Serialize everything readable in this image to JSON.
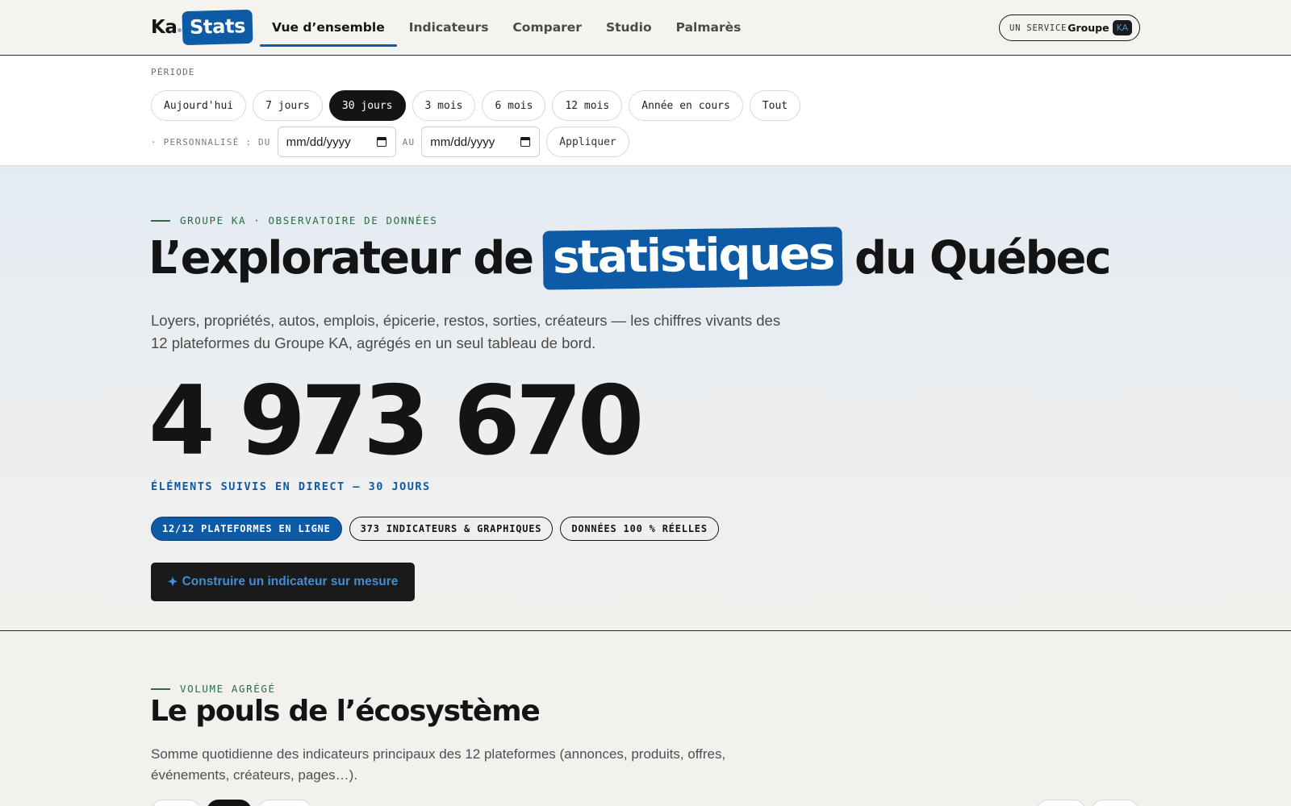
{
  "header": {
    "logo_ka": "Ka",
    "logo_stats": "Stats",
    "nav": [
      {
        "label": "Vue d’ensemble",
        "active": true
      },
      {
        "label": "Indicateurs",
        "active": false
      },
      {
        "label": "Comparer",
        "active": false
      },
      {
        "label": "Studio",
        "active": false
      },
      {
        "label": "Palmarès",
        "active": false
      }
    ],
    "service": {
      "prefix": "UN SERVICE",
      "groupe": "Groupe",
      "ka": "KA"
    }
  },
  "period": {
    "label": "PÉRIODE",
    "options": [
      {
        "label": "Aujourd'hui",
        "active": false
      },
      {
        "label": "7 jours",
        "active": false
      },
      {
        "label": "30 jours",
        "active": true
      },
      {
        "label": "3 mois",
        "active": false
      },
      {
        "label": "6 mois",
        "active": false
      },
      {
        "label": "12 mois",
        "active": false
      },
      {
        "label": "Année en cours",
        "active": false
      },
      {
        "label": "Tout",
        "active": false
      }
    ],
    "custom_label": "· PERSONNALISÉ : DU",
    "from_placeholder": "mm/dd/yyyy",
    "to_label": "AU",
    "to_placeholder": "mm/dd/yyyy",
    "apply_label": "Appliquer"
  },
  "hero": {
    "eyebrow": "GROUPE KA · OBSERVATOIRE DE DONNÉES",
    "title_before": "L’explorateur de",
    "title_highlight": "statistiques",
    "title_after": "du Québec",
    "subtitle": "Loyers, propriétés, autos, emplois, épicerie, restos, sorties, créateurs — les chiffres vivants des 12 plateformes du Groupe KA, agrégés en un seul tableau de bord.",
    "big_number": "4 973 670",
    "big_caption": "ÉLÉMENTS SUIVIS EN DIRECT — 30 JOURS",
    "badges": [
      {
        "label": "12/12 PLATEFORMES EN LIGNE",
        "variant": "blue"
      },
      {
        "label": "373 INDICATEURS & GRAPHIQUES",
        "variant": "outline"
      },
      {
        "label": "DONNÉES 100 % RÉELLES",
        "variant": "outline"
      }
    ],
    "cta_icon": "✦",
    "cta_label": "Construire un indicateur sur mesure"
  },
  "pulse": {
    "eyebrow": "VOLUME AGRÉGÉ",
    "title": "Le pouls de l’écosystème",
    "description": "Somme quotidienne des indicateurs principaux des 12 plateformes (annonces, produits, offres, événements, créateurs, pages…)."
  },
  "colors": {
    "accent_blue": "#0d5ba6",
    "eyebrow_green": "#2a6b4a",
    "ink": "#141414"
  }
}
